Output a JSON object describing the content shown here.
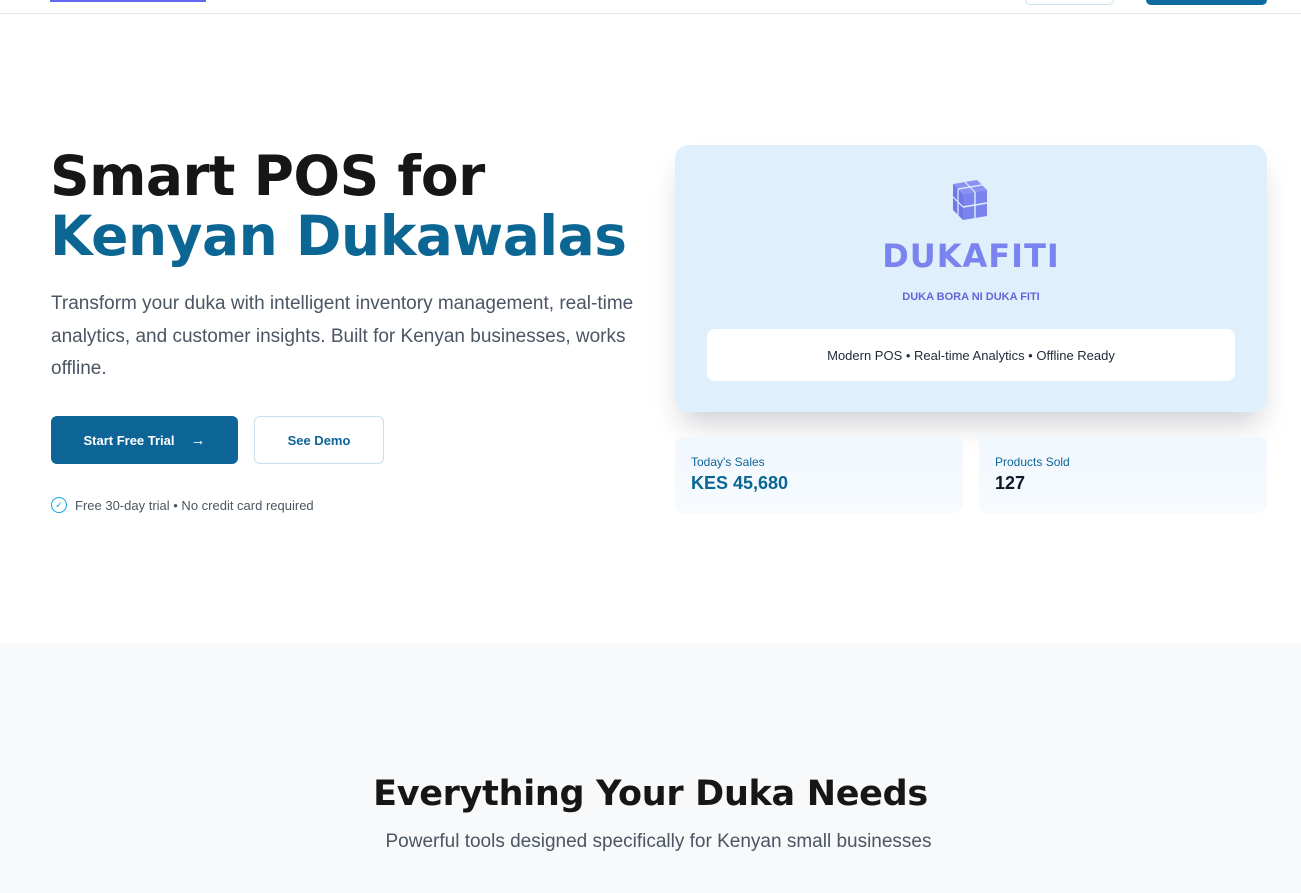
{
  "hero": {
    "title_line1": "Smart POS for",
    "title_line2": "Kenyan Dukawalas",
    "description": "Transform your duka with intelligent inventory management, real-time analytics, and customer insights. Built for Kenyan businesses, works offline.",
    "primary_button": "Start Free Trial",
    "secondary_button": "See Demo",
    "trial_note": "Free 30-day trial • No credit card required"
  },
  "brand_card": {
    "name": "DUKAFITI",
    "tagline": "DUKA BORA NI DUKA FITI",
    "features": "Modern POS • Real-time Analytics • Offline Ready"
  },
  "stats": [
    {
      "label": "Today's Sales",
      "value": "KES 45,680"
    },
    {
      "label": "Products Sold",
      "value": "127"
    }
  ],
  "features_section": {
    "title": "Everything Your Duka Needs",
    "subtitle": "Powerful tools designed specifically for Kenyan small businesses"
  },
  "colors": {
    "primary": "#0d6597",
    "accent_text": "#0b6694",
    "brand_purple": "#7b83ee",
    "card_bg": "#dff0fc"
  },
  "icons": {
    "logo": "cube-icon",
    "button_arrow": "arrow-right-icon",
    "trial_check": "check-circle-icon"
  }
}
